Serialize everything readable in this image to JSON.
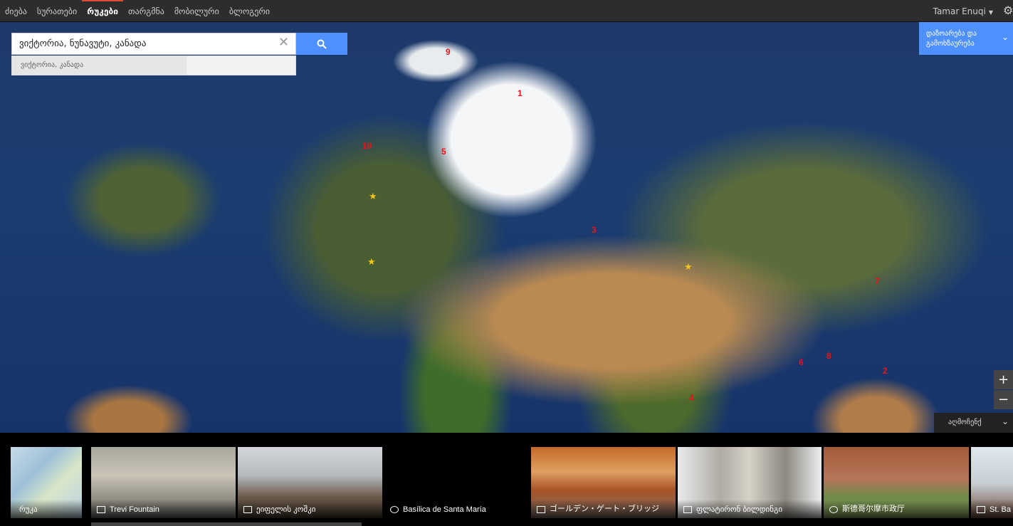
{
  "nav": {
    "items": [
      {
        "label": "ძიება",
        "active": false
      },
      {
        "label": "სურათები",
        "active": false
      },
      {
        "label": "რუკები",
        "active": true
      },
      {
        "label": "თარგმნა",
        "active": false
      },
      {
        "label": "მობილური",
        "active": false
      },
      {
        "label": "ბლოგერი",
        "active": false
      }
    ],
    "user_name": "Tamar Enuqi",
    "settings_icon": "gear-icon"
  },
  "search": {
    "value": "ვიქტორია, ნუნავუტი, კანადა",
    "suggestion": "ვიქტორია, კანადა",
    "button_icon": "search-icon"
  },
  "tour": {
    "label": "დაზოარება და გამოხზაურება"
  },
  "zoom": {
    "in_label": "+",
    "out_label": "−"
  },
  "explore": {
    "label": "აღმოჩენქ"
  },
  "map": {
    "markers": [
      "1",
      "2",
      "3",
      "4",
      "5",
      "6",
      "7",
      "8",
      "9",
      "10"
    ]
  },
  "carousel": {
    "cards": [
      {
        "label": "რუკა",
        "icon": "map-icon"
      },
      {
        "label": "Trevi Fountain",
        "icon": "photo-sphere-icon"
      },
      {
        "label": "ეიფელის კოშკი",
        "icon": "photo-sphere-icon"
      },
      {
        "label": "Basílica de Santa María",
        "icon": "panorama-icon"
      },
      {
        "label": "ゴールデン・ゲート・ブリッジ",
        "icon": "camera-icon"
      },
      {
        "label": "ფლატირონ ბილდინგი",
        "icon": "photo-sphere-icon"
      },
      {
        "label": "斯德哥尔摩市政厅",
        "icon": "panorama-icon"
      },
      {
        "label": "St. Ba",
        "icon": "photo-sphere-icon"
      }
    ]
  }
}
